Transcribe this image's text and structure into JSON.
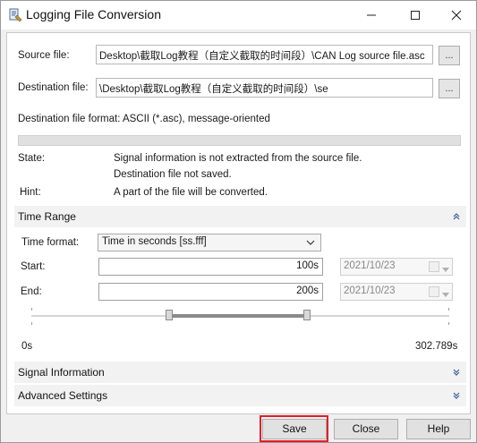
{
  "window": {
    "title": "Logging File Conversion",
    "icons": {
      "app": "app-icon",
      "minimize": "minimize-icon",
      "maximize": "maximize-icon",
      "close": "close-icon"
    }
  },
  "files": {
    "source_label": "Source file:",
    "source_value": "Desktop\\截取Log教程（自定义截取的时间段）\\CAN Log source file.asc",
    "destination_label": "Destination file:",
    "destination_value": "\\Desktop\\截取Log教程（自定义截取的时间段）\\se",
    "browse_label": "...",
    "format_text": "Destination file format: ASCII (*.asc), message-oriented"
  },
  "status": {
    "state_label": "State:",
    "state_line1": "Signal information is not extracted from the source file.",
    "state_line2": "Destination file not saved.",
    "hint_label": "Hint:",
    "hint_value": "A part of the file will be converted."
  },
  "time_range": {
    "title": "Time Range",
    "format_label": "Time format:",
    "format_value": "Time in seconds [ss.fff]",
    "start_label": "Start:",
    "start_value": "100s",
    "start_date": "2021/10/23",
    "end_label": "End:",
    "end_value": "200s",
    "end_date": "2021/10/23",
    "range_min": "0s",
    "range_max": "302.789s",
    "slider_start_fraction": 0.33,
    "slider_end_fraction": 0.66
  },
  "sections": {
    "signal_information": "Signal Information",
    "advanced_settings": "Advanced Settings"
  },
  "buttons": {
    "save": "Save",
    "close": "Close",
    "help": "Help"
  },
  "colors": {
    "highlight": "#e0202a"
  }
}
